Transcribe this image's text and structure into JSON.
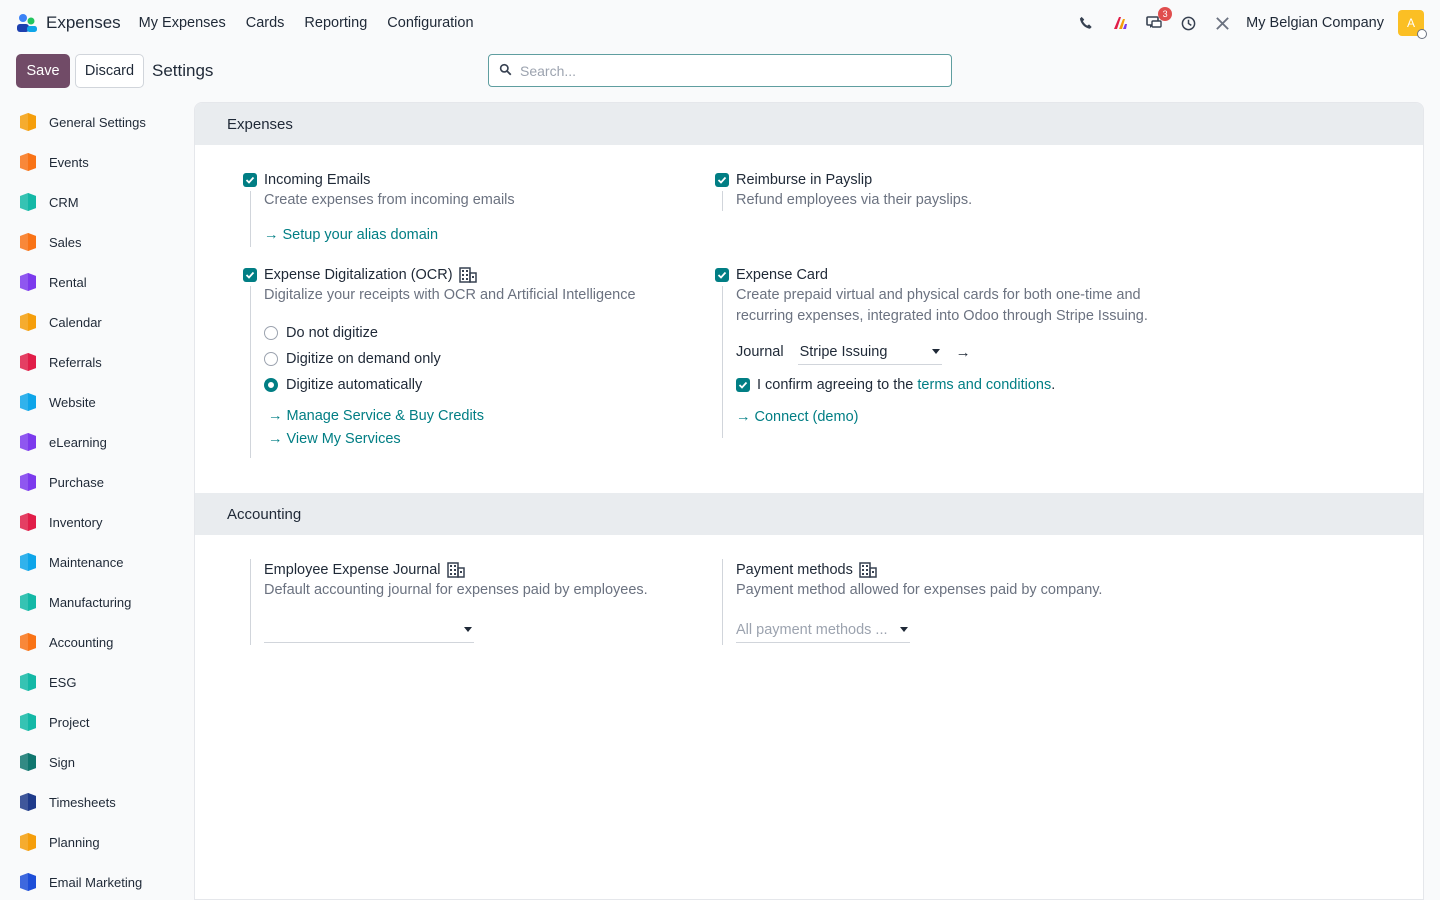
{
  "navbar": {
    "app_name": "Expenses",
    "menu": [
      "My Expenses",
      "Cards",
      "Reporting",
      "Configuration"
    ],
    "chat_badge": "3",
    "company": "My Belgian Company",
    "avatar_initial": "A"
  },
  "control": {
    "save_label": "Save",
    "discard_label": "Discard",
    "title": "Settings",
    "search_placeholder": "Search..."
  },
  "sidebar": {
    "items": [
      {
        "label": "General Settings",
        "icon": "general-settings-icon",
        "color": "#f59e0b"
      },
      {
        "label": "Events",
        "icon": "events-icon",
        "color": "#f97316"
      },
      {
        "label": "CRM",
        "icon": "crm-icon",
        "color": "#14b8a6"
      },
      {
        "label": "Sales",
        "icon": "sales-icon",
        "color": "#f97316"
      },
      {
        "label": "Rental",
        "icon": "rental-icon",
        "color": "#7c3aed"
      },
      {
        "label": "Calendar",
        "icon": "calendar-icon",
        "color": "#f59e0b"
      },
      {
        "label": "Referrals",
        "icon": "referrals-icon",
        "color": "#e11d48"
      },
      {
        "label": "Website",
        "icon": "website-icon",
        "color": "#0ea5e9"
      },
      {
        "label": "eLearning",
        "icon": "elearning-icon",
        "color": "#7c3aed"
      },
      {
        "label": "Purchase",
        "icon": "purchase-icon",
        "color": "#7c3aed"
      },
      {
        "label": "Inventory",
        "icon": "inventory-icon",
        "color": "#e11d48"
      },
      {
        "label": "Maintenance",
        "icon": "maintenance-icon",
        "color": "#0ea5e9"
      },
      {
        "label": "Manufacturing",
        "icon": "manufacturing-icon",
        "color": "#14b8a6"
      },
      {
        "label": "Accounting",
        "icon": "accounting-icon",
        "color": "#f97316"
      },
      {
        "label": "ESG",
        "icon": "esg-icon",
        "color": "#14b8a6"
      },
      {
        "label": "Project",
        "icon": "project-icon",
        "color": "#14b8a6"
      },
      {
        "label": "Sign",
        "icon": "sign-icon",
        "color": "#0f766e"
      },
      {
        "label": "Timesheets",
        "icon": "timesheets-icon",
        "color": "#1e3a8a"
      },
      {
        "label": "Planning",
        "icon": "planning-icon",
        "color": "#f59e0b"
      },
      {
        "label": "Email Marketing",
        "icon": "email-marketing-icon",
        "color": "#1d4ed8"
      }
    ]
  },
  "expenses": {
    "heading": "Expenses",
    "incoming_emails": {
      "title": "Incoming Emails",
      "desc": "Create expenses from incoming emails",
      "link": "Setup your alias domain"
    },
    "reimburse": {
      "title": "Reimburse in Payslip",
      "desc": "Refund employees via their payslips."
    },
    "ocr": {
      "title": "Expense Digitalization (OCR)",
      "desc": "Digitalize your receipts with OCR and Artificial Intelligence",
      "options": [
        "Do not digitize",
        "Digitize on demand only",
        "Digitize automatically"
      ],
      "selected": 2,
      "link1": "Manage Service & Buy Credits",
      "link2": "View My Services"
    },
    "card": {
      "title": "Expense Card",
      "desc_line1": "Create prepaid virtual and physical cards for both one-time and",
      "desc_line2": "recurring expenses, integrated into Odoo through Stripe Issuing.",
      "journal_label": "Journal",
      "journal_value": "Stripe Issuing",
      "confirm_text": "I confirm agreeing to the",
      "terms_link": "terms and conditions",
      "confirm_end": ".",
      "connect_link": "Connect (demo)"
    }
  },
  "accounting": {
    "heading": "Accounting",
    "journal": {
      "title": "Employee Expense Journal",
      "desc": "Default accounting journal for expenses paid by employees."
    },
    "payment": {
      "title": "Payment methods",
      "desc": "Payment method allowed for expenses paid by company.",
      "placeholder": "All payment methods ..."
    }
  },
  "colors": {
    "primary": "#714b67",
    "accent": "#017e84"
  }
}
